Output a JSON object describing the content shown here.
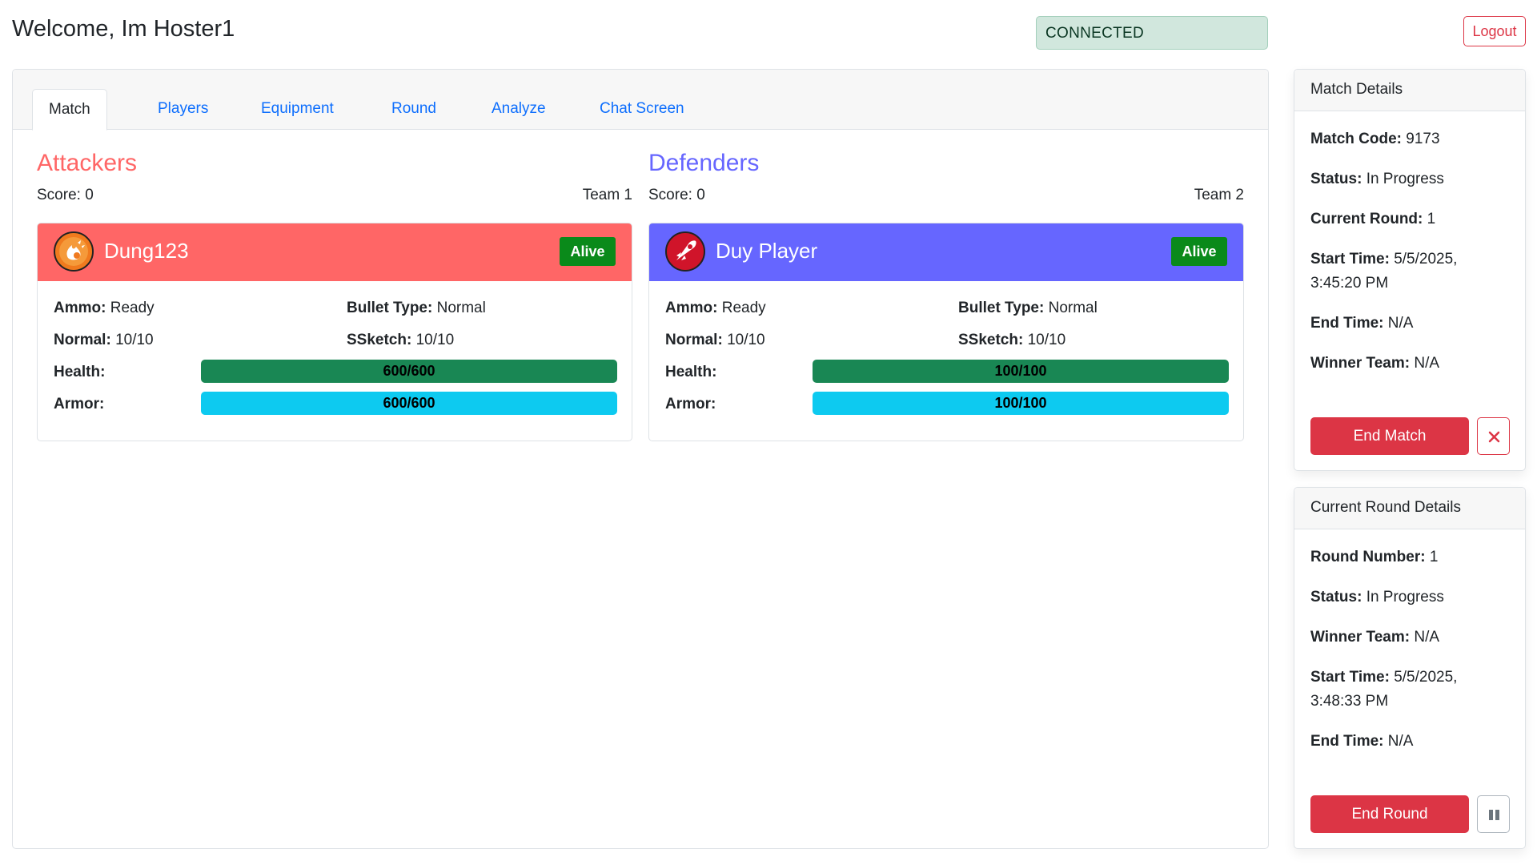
{
  "header": {
    "welcome": "Welcome, Im Hoster1",
    "connection_status": "CONNECTED",
    "logout_label": "Logout"
  },
  "tabs": [
    {
      "label": "Match",
      "active": true
    },
    {
      "label": "Players",
      "active": false
    },
    {
      "label": "Equipment",
      "active": false
    },
    {
      "label": "Round",
      "active": false
    },
    {
      "label": "Analyze",
      "active": false
    },
    {
      "label": "Chat Screen",
      "active": false
    }
  ],
  "teams": {
    "attackers": {
      "title": "Attackers",
      "score": "Score: 0",
      "team_label": "Team 1",
      "color": "#ff6666",
      "player": {
        "name": "Dung123",
        "avatar_icon": "flame-icon",
        "status": "Alive",
        "ammo_label": "Ammo:",
        "ammo_value": "Ready",
        "bullet_type_label": "Bullet Type:",
        "bullet_type_value": "Normal",
        "normal_label": "Normal:",
        "normal_value": "10/10",
        "ssketch_label": "SSketch:",
        "ssketch_value": "10/10",
        "health_label": "Health:",
        "health_text": "600/600",
        "health_fraction": 1.0,
        "armor_label": "Armor:",
        "armor_text": "600/600",
        "armor_fraction": 1.0
      }
    },
    "defenders": {
      "title": "Defenders",
      "score": "Score: 0",
      "team_label": "Team 2",
      "color": "#6666ff",
      "player": {
        "name": "Duy Player",
        "avatar_icon": "rocket-icon",
        "status": "Alive",
        "ammo_label": "Ammo:",
        "ammo_value": "Ready",
        "bullet_type_label": "Bullet Type:",
        "bullet_type_value": "Normal",
        "normal_label": "Normal:",
        "normal_value": "10/10",
        "ssketch_label": "SSketch:",
        "ssketch_value": "10/10",
        "health_label": "Health:",
        "health_text": "100/100",
        "health_fraction": 1.0,
        "armor_label": "Armor:",
        "armor_text": "100/100",
        "armor_fraction": 1.0
      }
    }
  },
  "match_details": {
    "title": "Match Details",
    "code_label": "Match Code:",
    "code_value": "9173",
    "status_label": "Status:",
    "status_value": "In Progress",
    "round_label": "Current Round:",
    "round_value": "1",
    "start_label": "Start Time:",
    "start_value": "5/5/2025, 3:45:20 PM",
    "end_label": "End Time:",
    "end_value": "N/A",
    "winner_label": "Winner Team:",
    "winner_value": "N/A",
    "end_button": "End Match",
    "close_icon": "close-icon"
  },
  "round_details": {
    "title": "Current Round Details",
    "number_label": "Round Number:",
    "number_value": "1",
    "status_label": "Status:",
    "status_value": "In Progress",
    "winner_label": "Winner Team:",
    "winner_value": "N/A",
    "start_label": "Start Time:",
    "start_value": "5/5/2025, 3:48:33 PM",
    "end_label": "End Time:",
    "end_value": "N/A",
    "end_button": "End Round",
    "pause_icon": "pause-icon"
  },
  "colors": {
    "health": "#198754",
    "armor": "#0dcaf0",
    "danger": "#dc3545",
    "alive": "#0a8a1a"
  }
}
